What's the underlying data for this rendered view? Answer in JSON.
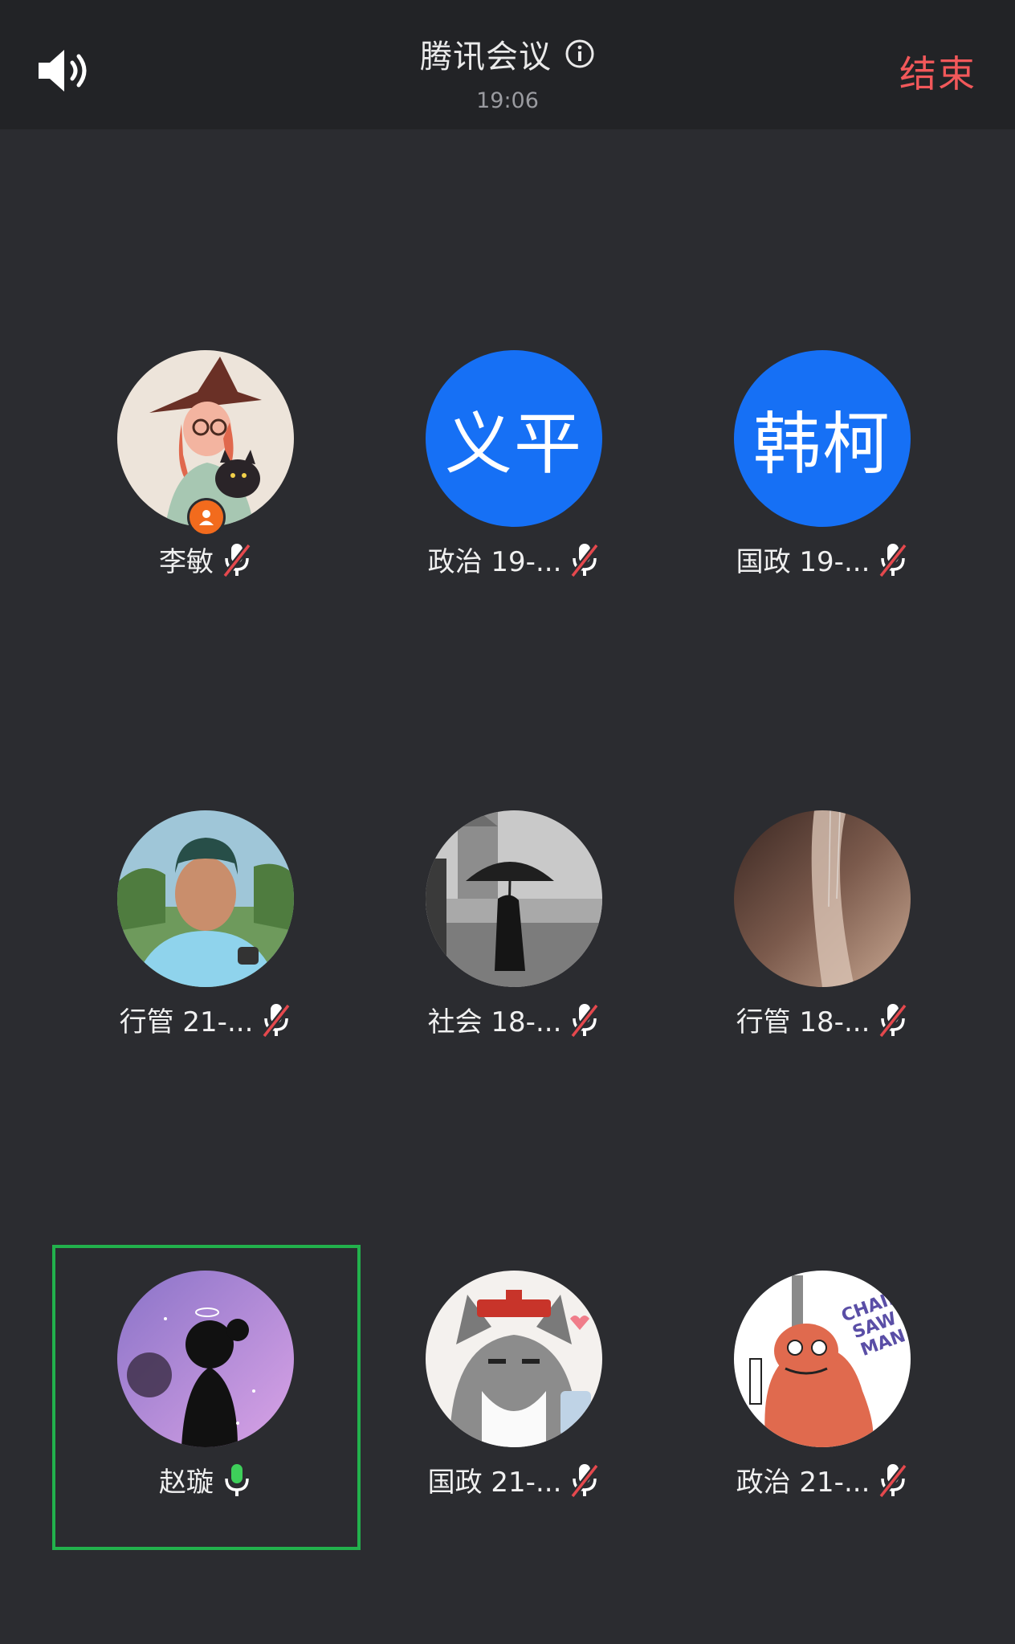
{
  "header": {
    "title": "腾讯会议",
    "time": "19:06",
    "end_label": "结束"
  },
  "participants": [
    {
      "name": "李敏",
      "avatar_type": "image",
      "avatar_desc": "witch-with-cat",
      "mic": "muted",
      "host": true
    },
    {
      "name": "政治 19-...",
      "avatar_type": "text",
      "avatar_text": "义平",
      "mic": "muted"
    },
    {
      "name": "国政 19-...",
      "avatar_type": "text",
      "avatar_text": "韩柯",
      "mic": "muted"
    },
    {
      "name": "行管 21-...",
      "avatar_type": "image",
      "avatar_desc": "man-with-cap",
      "mic": "muted"
    },
    {
      "name": "社会 18-...",
      "avatar_type": "image",
      "avatar_desc": "umbrella-street",
      "mic": "muted"
    },
    {
      "name": "行管 18-...",
      "avatar_type": "image",
      "avatar_desc": "blurred-photo",
      "mic": "muted"
    },
    {
      "name": "赵璇",
      "avatar_type": "image",
      "avatar_desc": "silhouette-purple",
      "mic": "active",
      "speaking": true
    },
    {
      "name": "国政 21-...",
      "avatar_type": "image",
      "avatar_desc": "cartoon-cat",
      "mic": "muted"
    },
    {
      "name": "政治 21-...",
      "avatar_type": "image",
      "avatar_desc": "chainsaw-dog",
      "mic": "muted",
      "avatar_lettering": "CHAIN SAW MAN"
    }
  ],
  "colors": {
    "background": "#2b2c30",
    "topbar": "#222326",
    "end": "#f2585a",
    "text_avatar": "#1670f5",
    "active_border": "#22b14c",
    "mic_active": "#3ecf5a",
    "mute_slash": "#e5484d",
    "host_badge": "#f26b1d"
  }
}
